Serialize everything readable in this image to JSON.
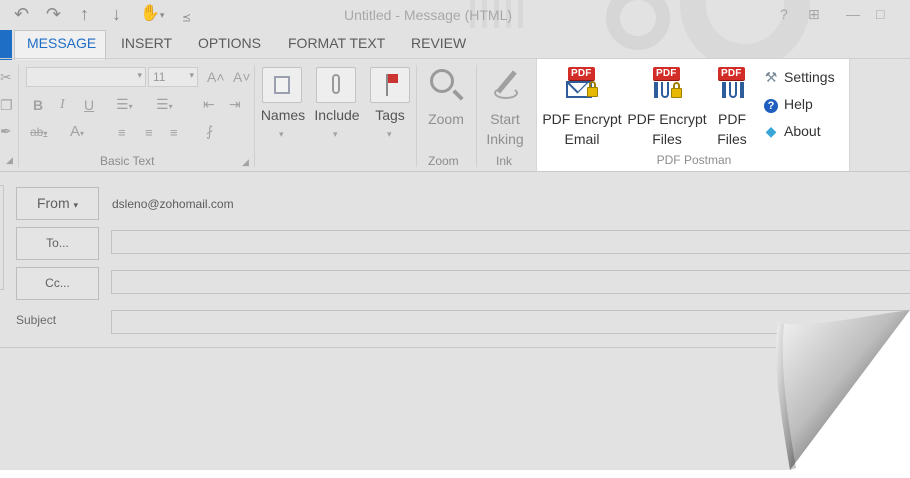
{
  "window": {
    "title": "Untitled - Message (HTML)",
    "help_label": "?"
  },
  "tabs": [
    {
      "label": "MESSAGE",
      "active": true
    },
    {
      "label": "INSERT"
    },
    {
      "label": "OPTIONS"
    },
    {
      "label": "FORMAT TEXT"
    },
    {
      "label": "REVIEW"
    }
  ],
  "basic_text": {
    "font_size": "11",
    "group_label": "Basic Text"
  },
  "names_group": {
    "names_label": "Names",
    "include_label": "Include",
    "tags_label": "Tags"
  },
  "zoom_group": {
    "button_label": "Zoom",
    "group_label": "Zoom"
  },
  "ink_group": {
    "button_line1": "Start",
    "button_line2": "Inking",
    "group_label": "Ink"
  },
  "pdf_postman": {
    "badge_text": "PDF",
    "encrypt_email_line1": "PDF Encrypt",
    "encrypt_email_line2": "Email",
    "encrypt_files_line1": "PDF Encrypt",
    "encrypt_files_line2": "Files",
    "pdf_files_line1": "PDF",
    "pdf_files_line2": "Files",
    "settings_label": "Settings",
    "help_label": "Help",
    "about_label": "About",
    "group_label": "PDF Postman"
  },
  "form": {
    "from_label": "From",
    "from_address": "dsleno@zohomail.com",
    "to_label": "To...",
    "cc_label": "Cc...",
    "subject_label": "Subject"
  },
  "colors": {
    "accent_blue": "#1f6ec6",
    "pdf_red": "#d22d26"
  }
}
